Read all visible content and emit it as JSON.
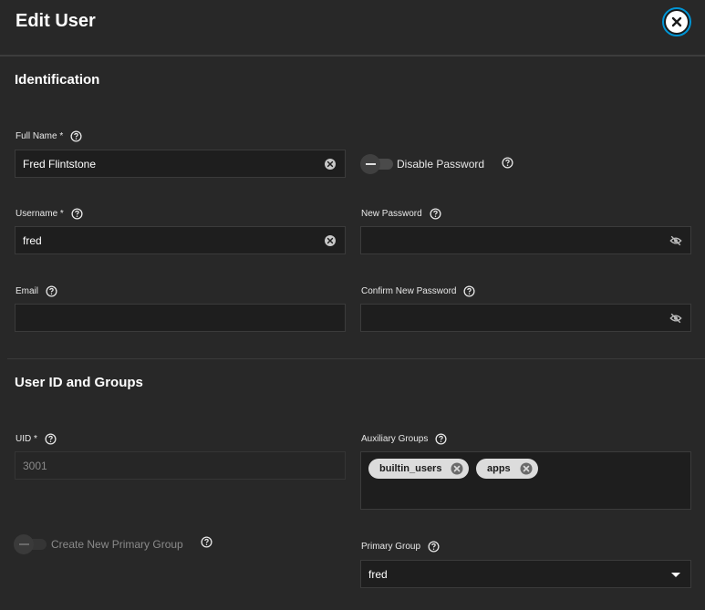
{
  "header": {
    "title": "Edit User",
    "close_icon": "close-icon"
  },
  "identification": {
    "title": "Identification",
    "full_name": {
      "label": "Full Name *",
      "value": "Fred Flintstone"
    },
    "disable_password": {
      "label": "Disable Password",
      "on": false
    },
    "username": {
      "label": "Username *",
      "value": "fred"
    },
    "new_password": {
      "label": "New Password",
      "value": ""
    },
    "email": {
      "label": "Email",
      "value": ""
    },
    "confirm_password": {
      "label": "Confirm New Password",
      "value": ""
    }
  },
  "user_groups": {
    "title": "User ID and Groups",
    "uid": {
      "label": "UID *",
      "value": "3001"
    },
    "auxiliary_groups": {
      "label": "Auxiliary Groups",
      "chips": [
        "builtin_users",
        "apps"
      ]
    },
    "create_primary_group": {
      "label": "Create New Primary Group",
      "on": false,
      "disabled": true
    },
    "primary_group": {
      "label": "Primary Group",
      "value": "fred"
    }
  },
  "colors": {
    "background": "#282828",
    "field_bg": "#1e1e1e",
    "accent": "#0095d5",
    "chip_bg": "#dcdcdc"
  }
}
